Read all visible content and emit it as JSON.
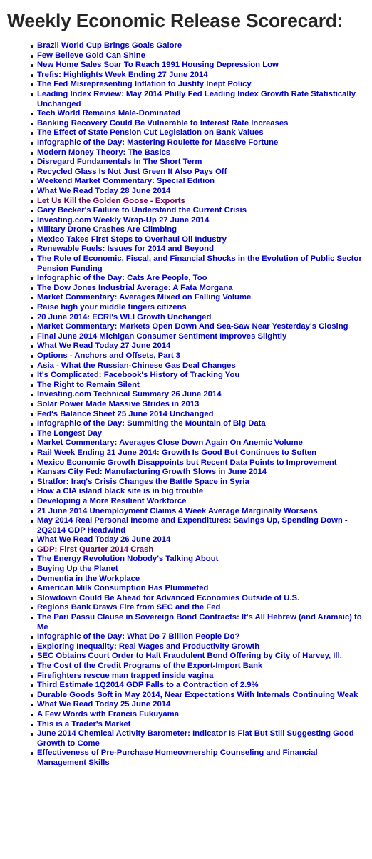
{
  "page": {
    "title": "Weekly Economic Release Scorecard:",
    "colors": {
      "link": "#0000CC",
      "visited_link": "#660066",
      "title": "#262626",
      "bullet": "#111111",
      "background": "#FFFFFF"
    }
  },
  "list": {
    "items": [
      {
        "label": "Brazil World Cup Brings Goals Galore",
        "state": "link"
      },
      {
        "label": "Few Believe Gold Can Shine",
        "state": "link"
      },
      {
        "label": "New Home Sales Soar To Reach 1991 Housing Depression Low",
        "state": "link"
      },
      {
        "label": "Trefis: Highlights Week Ending 27 June 2014",
        "state": "link"
      },
      {
        "label": "The Fed Misrepresenting Inflation to Justify Inept Policy",
        "state": "link"
      },
      {
        "label": "Leading Index Review: May 2014 Philly Fed Leading Index Growth Rate Statistically Unchanged",
        "state": "link"
      },
      {
        "label": "Tech World Remains Male-Dominated",
        "state": "link"
      },
      {
        "label": "Banking Recovery Could Be Vulnerable to Interest Rate Increases",
        "state": "link"
      },
      {
        "label": "The Effect of State Pension Cut Legislation on Bank Values",
        "state": "link"
      },
      {
        "label": "Infographic of the Day: Mastering Roulette for Massive Fortune",
        "state": "link"
      },
      {
        "label": "Modern Money Theory: The Basics",
        "state": "link"
      },
      {
        "label": "Disregard Fundamentals In The Short Term",
        "state": "link"
      },
      {
        "label": "Recycled Glass Is Not Just Green It Also Pays Off",
        "state": "link"
      },
      {
        "label": "Weekend Market Commentary: Special Edition",
        "state": "link"
      },
      {
        "label": "What We Read Today 28 June 2014",
        "state": "link"
      },
      {
        "label": "Let Us Kill the Golden Goose - Exports",
        "state": "visited"
      },
      {
        "label": "Gary Becker's Failure to Understand the Current Crisis",
        "state": "link"
      },
      {
        "label": "Investing.com Weekly Wrap-Up 27 June 2014",
        "state": "link"
      },
      {
        "label": "Military Drone Crashes Are Climbing",
        "state": "link"
      },
      {
        "label": "Mexico Takes First Steps to Overhaul Oil Industry",
        "state": "link"
      },
      {
        "label": "Renewable Fuels: Issues for 2014 and Beyond",
        "state": "link"
      },
      {
        "label": "The Role of Economic, Fiscal, and Financial Shocks in the Evolution of Public Sector Pension Funding",
        "state": "link"
      },
      {
        "label": "Infographic of the Day: Cats Are People, Too",
        "state": "link"
      },
      {
        "label": "The Dow Jones Industrial Average: A Fata Morgana",
        "state": "link"
      },
      {
        "label": "Market Commentary: Averages Mixed on Falling Volume",
        "state": "link"
      },
      {
        "label": "Raise high your middle fingers citizens",
        "state": "link"
      },
      {
        "label": "20 June 2014: ECRI's WLI Growth Unchanged",
        "state": "link"
      },
      {
        "label": "Market Commentary: Markets Open Down And Sea-Saw Near Yesterday's Closing",
        "state": "link"
      },
      {
        "label": "Final June 2014 Michigan Consumer Sentiment Improves Slightly",
        "state": "link"
      },
      {
        "label": "What We Read Today 27 June 2014",
        "state": "link"
      },
      {
        "label": "Options - Anchors and Offsets, Part 3",
        "state": "link"
      },
      {
        "label": "Asia - What the Russian-Chinese Gas Deal Changes",
        "state": "link"
      },
      {
        "label": "It's Complicated: Facebook's History of Tracking You",
        "state": "link"
      },
      {
        "label": "The Right to Remain Silent",
        "state": "link"
      },
      {
        "label": "Investing.com Technical Summary 26 June 2014",
        "state": "link"
      },
      {
        "label": "Solar Power Made Massive Strides in 2013",
        "state": "link"
      },
      {
        "label": "Fed's Balance Sheet 25 June 2014 Unchanged",
        "state": "link"
      },
      {
        "label": "Infographic of the Day: Summiting the Mountain of Big Data",
        "state": "link"
      },
      {
        "label": "The Longest Day",
        "state": "link"
      },
      {
        "label": "Market Commentary: Averages Close Down Again On Anemic Volume",
        "state": "link"
      },
      {
        "label": "Rail Week Ending 21 June 2014: Growth Is Good But Continues to Soften",
        "state": "link"
      },
      {
        "label": "Mexico Economic Growth Disappoints but Recent Data Points to Improvement",
        "state": "link"
      },
      {
        "label": "Kansas City Fed: Manufacturing Growth Slows in June 2014",
        "state": "link"
      },
      {
        "label": "Stratfor: Iraq's Crisis Changes the Battle Space in Syria",
        "state": "link"
      },
      {
        "label": "How a CIA island black site is in big trouble",
        "state": "link"
      },
      {
        "label": "Developing a More Resilient Workforce",
        "state": "link"
      },
      {
        "label": "21 June 2014 Unemployment Claims 4 Week Average Marginally Worsens",
        "state": "link"
      },
      {
        "label": "May 2014 Real Personal Income and Expenditures: Savings Up, Spending Down - 2Q2014 GDP Headwind",
        "state": "link"
      },
      {
        "label": "What We Read Today 26 June 2014",
        "state": "link"
      },
      {
        "label": "GDP: First Quarter 2014 Crash",
        "state": "visited"
      },
      {
        "label": "The Energy Revolution Nobody's Talking About",
        "state": "link"
      },
      {
        "label": "Buying Up the Planet",
        "state": "link"
      },
      {
        "label": "Dementia in the Workplace",
        "state": "link"
      },
      {
        "label": "American Milk Consumption Has Plummeted",
        "state": "link"
      },
      {
        "label": "Slowdown Could Be Ahead for Advanced Economies Outside of U.S.",
        "state": "link"
      },
      {
        "label": "Regions Bank Draws Fire from SEC and the Fed",
        "state": "link"
      },
      {
        "label": "The Pari Passu Clause in Sovereign Bond Contracts: It's All Hebrew (and Aramaic) to Me",
        "state": "link"
      },
      {
        "label": "Infographic of the Day: What Do 7 Billion People Do?",
        "state": "link"
      },
      {
        "label": "Exploring Inequality: Real Wages and Productivity Growth",
        "state": "link"
      },
      {
        "label": "SEC Obtains Court Order to Halt Fraudulent Bond Offering by City of Harvey, Ill.",
        "state": "link"
      },
      {
        "label": "The Cost of the Credit Programs of the Export-Import Bank",
        "state": "link"
      },
      {
        "label": "Firefighters rescue man trapped inside vagina",
        "state": "link"
      },
      {
        "label": "Third Estimate 1Q2014 GDP Falls to a Contraction of 2.9%",
        "state": "link"
      },
      {
        "label": "Durable Goods Soft in May 2014, Near Expectations With Internals Continuing Weak",
        "state": "link"
      },
      {
        "label": "What We Read Today 25 June 2014",
        "state": "link"
      },
      {
        "label": "A Few Words with Francis Fukuyama",
        "state": "link"
      },
      {
        "label": "This is a Trader's Market",
        "state": "link"
      },
      {
        "label": "June 2014 Chemical Activity Barometer: Indicator Is Flat But Still Suggesting Good Growth to Come",
        "state": "link"
      },
      {
        "label": "Effectiveness of Pre-Purchase Homeownership Counseling and Financial Management Skills",
        "state": "link"
      }
    ]
  }
}
